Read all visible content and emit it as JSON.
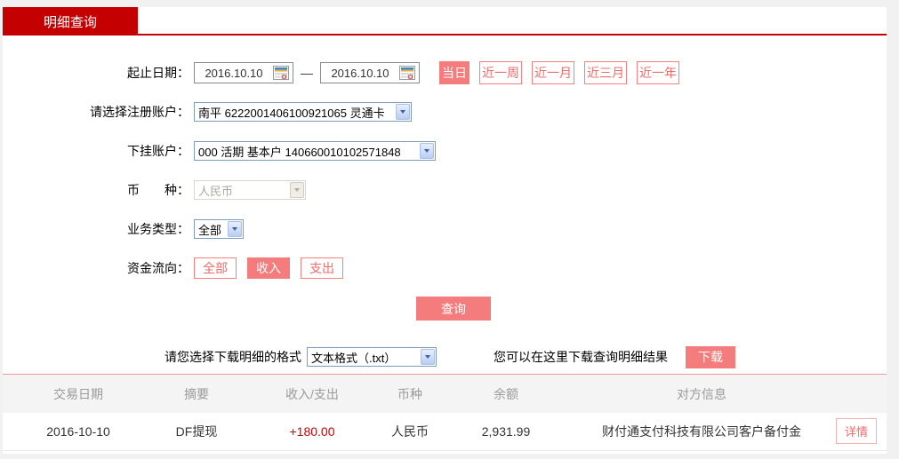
{
  "tab": {
    "label": "明细查询"
  },
  "form": {
    "date_range": {
      "label": "起止日期：",
      "start_value": "2016.10.10",
      "end_value": "2016.10.10",
      "separator": "—",
      "quick_buttons": [
        {
          "label": "当日",
          "active": true
        },
        {
          "label": "近一周",
          "active": false
        },
        {
          "label": "近一月",
          "active": false
        },
        {
          "label": "近三月",
          "active": false
        },
        {
          "label": "近一年",
          "active": false
        }
      ]
    },
    "registered_account": {
      "label": "请选择注册账户：",
      "value": "南平 6222001406100921065 灵通卡"
    },
    "sub_account": {
      "label": "下挂账户：",
      "value": "000 活期 基本户 140660010102571848"
    },
    "currency": {
      "label": "币　　种：",
      "value": "人民币",
      "disabled": true
    },
    "business_type": {
      "label": "业务类型：",
      "value": "全部"
    },
    "fund_flow": {
      "label": "资金流向：",
      "options": [
        {
          "label": "全部",
          "active": false
        },
        {
          "label": "收入",
          "active": true
        },
        {
          "label": "支出",
          "active": false
        }
      ]
    },
    "query_button": "查询"
  },
  "download": {
    "format_label": "请您选择下载明细的格式",
    "format_value": "文本格式（.txt）",
    "hint": "您可以在这里下载查询明细结果",
    "button": "下载"
  },
  "table": {
    "headers": [
      "交易日期",
      "摘要",
      "收入/支出",
      "币种",
      "余额",
      "对方信息"
    ],
    "rows": [
      {
        "date": "2016-10-10",
        "summary": "DF提现",
        "amount": "+180.00",
        "currency": "人民币",
        "balance": "2,931.99",
        "counterparty": "财付通支付科技有限公司客户备付金",
        "detail_button": "详情"
      }
    ]
  },
  "colors": {
    "tab_red": "#c40000",
    "accent_salmon": "#f47c7c",
    "amount_red": "#cc0000",
    "divider_pink": "#f19999"
  }
}
